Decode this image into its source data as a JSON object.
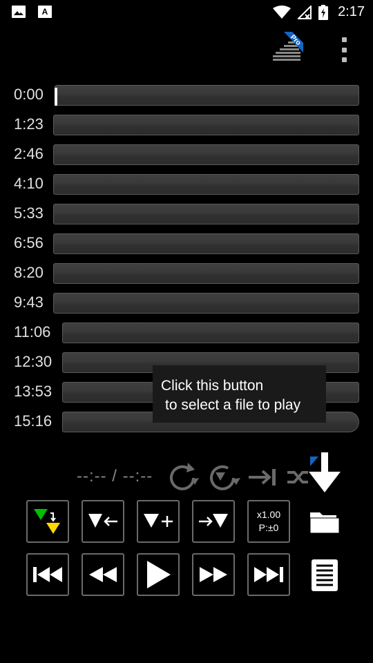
{
  "status_bar": {
    "time": "2:17",
    "left_icons": [
      "image-notification-icon",
      "font-notification-icon"
    ],
    "right_icons": [
      "wifi-icon",
      "no-signal-icon",
      "battery-charging-icon"
    ]
  },
  "app_bar": {
    "logo": "pro-app-logo",
    "logo_badge": "Pro",
    "menu_icon": "overflow-menu-icon"
  },
  "timeline": {
    "rows": [
      {
        "time": "0:00"
      },
      {
        "time": "1:23"
      },
      {
        "time": "2:46"
      },
      {
        "time": "4:10"
      },
      {
        "time": "5:33"
      },
      {
        "time": "6:56"
      },
      {
        "time": "8:20"
      },
      {
        "time": "9:43"
      },
      {
        "time": "11:06"
      },
      {
        "time": "12:30"
      },
      {
        "time": "13:53"
      },
      {
        "time": "15:16"
      }
    ]
  },
  "tooltip": {
    "line1": "Click this button",
    "line2": "to select a file to play"
  },
  "controls": {
    "position_text": "--:-- / --:--",
    "icons_row": [
      "repeat-icon",
      "repeat-marker-icon",
      "skip-to-marker-icon",
      "shuffle-icon",
      "pro-badge-icon"
    ],
    "speed_label": "x1.00",
    "pitch_label": "P:±0"
  },
  "colors": {
    "background": "#000000",
    "marker_green": "#00c000",
    "marker_yellow": "#ffd800",
    "pro_blue": "#1565c0"
  }
}
